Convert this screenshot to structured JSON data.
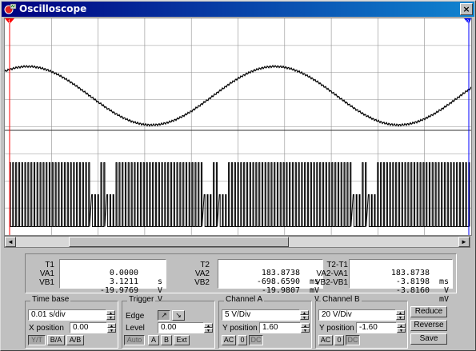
{
  "window": {
    "title": "Oscilloscope",
    "close": "×"
  },
  "scope": {
    "background": "#ffffff",
    "grid_color": "#909090",
    "trace_color": "#000000",
    "cursor1_color": "#ff0000",
    "cursor2_color": "#0000ff",
    "cursor1_label": "1",
    "cursor2_label": "2"
  },
  "scrollbar": {
    "left_arrow": "◄",
    "right_arrow": "►"
  },
  "readout": {
    "t1_label": "T1",
    "t1_value": "0.0000",
    "t1_unit": "s",
    "va1_label": "VA1",
    "va1_value": "3.1211",
    "va1_unit": "V",
    "vb1_label": "VB1",
    "vb1_value": "-19.9769",
    "vb1_unit": "V",
    "t2_label": "T2",
    "t2_value": "183.8738",
    "t2_unit": "ms",
    "va2_label": "VA2",
    "va2_value": "-698.6590",
    "va2_unit": "mV",
    "vb2_label": "VB2",
    "vb2_value": "-19.9807",
    "vb2_unit": "V",
    "dt_label": "T2-T1",
    "dt_value": "183.8738",
    "dt_unit": "ms",
    "dva_label": "VA2-VA1",
    "dva_value": "-3.8198",
    "dva_unit": "V",
    "dvb_label": "VB2-VB1",
    "dvb_value": "-3.8160",
    "dvb_unit": "mV"
  },
  "timebase": {
    "title": "Time base",
    "scale": "0.01 s/div",
    "xpos_label": "X position",
    "xpos_value": "0.00",
    "btn_yt": "Y/T",
    "btn_ba": "B/A",
    "btn_ab": "A/B"
  },
  "trigger": {
    "title": "Trigger",
    "edge_label": "Edge",
    "level_label": "Level",
    "level_value": "0.00",
    "edge_rise": "↗",
    "edge_fall": "↘",
    "btn_auto": "Auto",
    "btn_a": "A",
    "btn_b": "B",
    "btn_ext": "Ext"
  },
  "channel_a": {
    "title": "Channel A",
    "scale": "5 V/Div",
    "ypos_label": "Y position",
    "ypos_value": "1.60",
    "btn_ac": "AC",
    "btn_0": "0",
    "btn_dc": "DC"
  },
  "channel_b": {
    "title": "Channel B",
    "scale": "20 V/Div",
    "ypos_label": "Y position",
    "ypos_value": "-1.60",
    "btn_ac": "AC",
    "btn_0": "0",
    "btn_dc": "DC"
  },
  "actions": {
    "reduce": "Reduce",
    "reverse": "Reverse",
    "save": "Save"
  },
  "chart_data": {
    "type": "line",
    "series": [
      {
        "period_divisions": 5.3,
        "phase_divisions": -0.5,
        "shape": "sine with fine ripple"
      },
      {
        "shape": "PWM pulse train",
        "high_divisions": 1.6,
        "low_divisions": -0.5,
        "gaps_divisions": [
          2.1,
          4.5,
          7.7
        ]
      }
    ],
    "x_divisions": 10,
    "y_divisions": 8,
    "grid": true
  }
}
